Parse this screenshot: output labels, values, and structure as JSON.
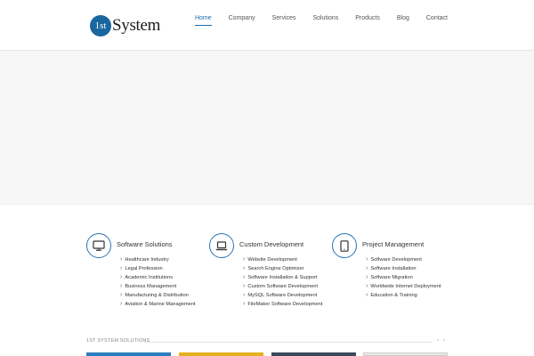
{
  "logo": {
    "badge": "1st",
    "word": "System"
  },
  "nav": [
    {
      "label": "Home"
    },
    {
      "label": "Company"
    },
    {
      "label": "Services"
    },
    {
      "label": "Solutions"
    },
    {
      "label": "Products"
    },
    {
      "label": "Blog"
    },
    {
      "label": "Contact"
    }
  ],
  "services": [
    {
      "icon": "monitor-icon",
      "title": "Software Solutions",
      "items": [
        "Healthcare Industry",
        "Legal Profession",
        "Academic Institutions",
        "Business Management",
        "Manufacturing & Distribution",
        "Aviation & Marine Management"
      ]
    },
    {
      "icon": "laptop-icon",
      "title": "Custom Development",
      "items": [
        "Website Development",
        "Search Engine Optimizer",
        "Software Installation & Support",
        "Custom Software Development",
        "MySQL Software Development",
        "FileMaker Software Development"
      ]
    },
    {
      "icon": "tablet-icon",
      "title": "Project Management",
      "items": [
        "Software Development",
        "Software Installation",
        "Software Migration",
        "Worldwide Internet Deployment",
        "Education & Training"
      ]
    }
  ],
  "section": {
    "title": "1ST SYSTEM SOLUTIONS",
    "prev": "‹",
    "next": "›"
  },
  "colors": {
    "accent": "#1a6fb0",
    "thumb1": "#2c7fc0",
    "thumb2": "#e5b21f",
    "thumb3": "#3a4a5a",
    "thumb4": "#d8d8d8"
  }
}
